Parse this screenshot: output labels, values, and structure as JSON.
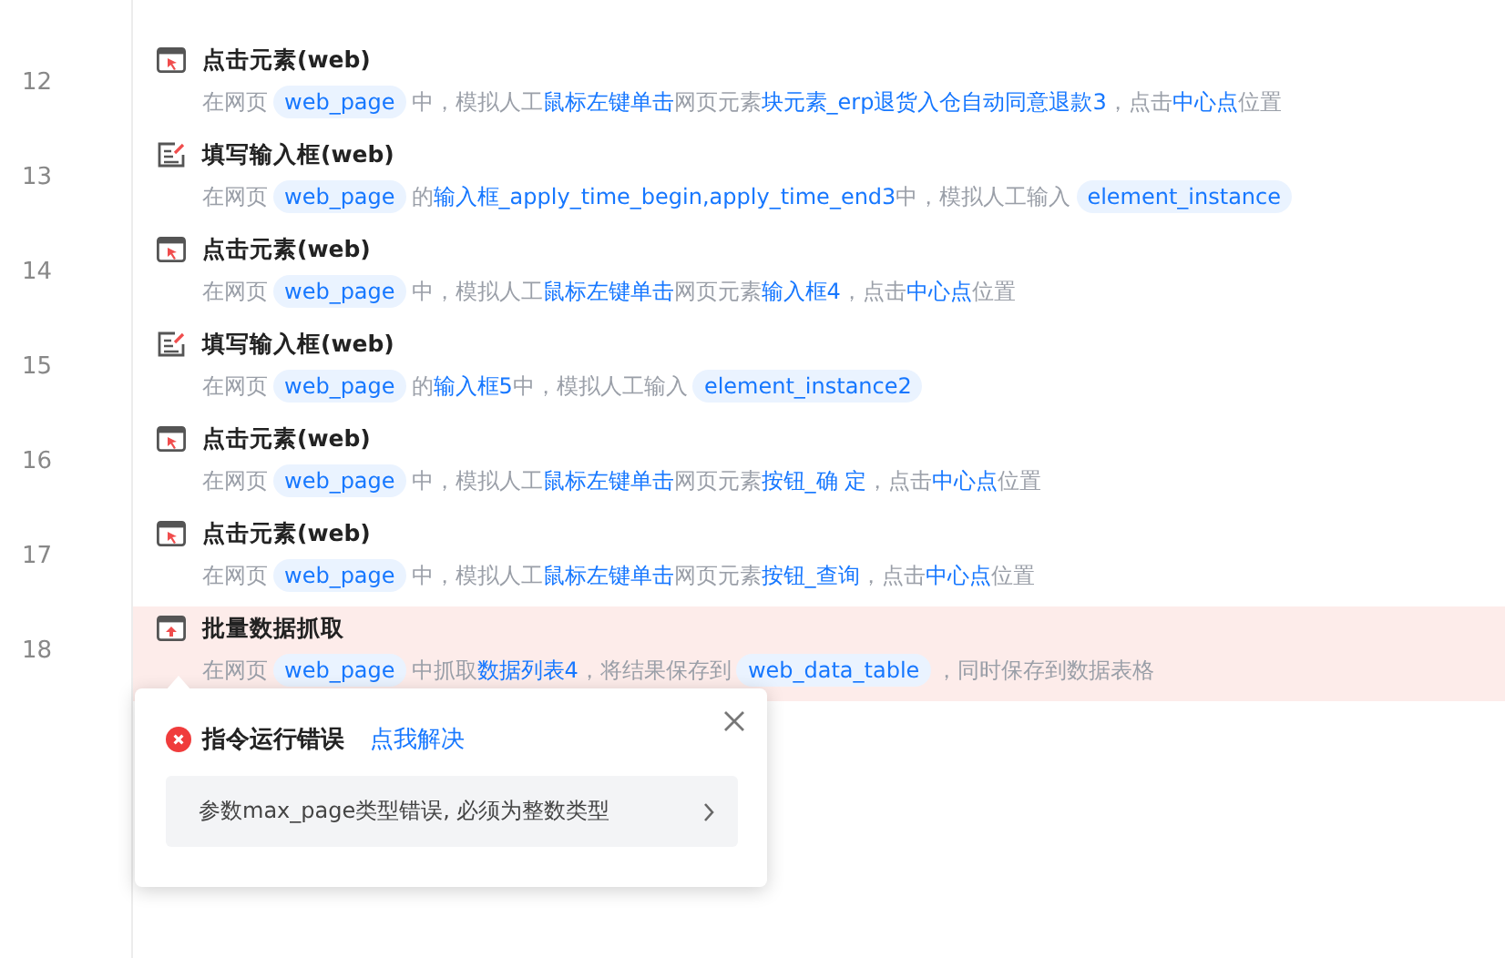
{
  "steps": [
    {
      "number": "12",
      "kind": "click",
      "title": "点击元素(web)",
      "error": false,
      "description": [
        {
          "kind": "text",
          "text": "在网页"
        },
        {
          "kind": "chip",
          "text": "web_page"
        },
        {
          "kind": "text",
          "text": "中，模拟人工"
        },
        {
          "kind": "link",
          "text": "鼠标左键单击"
        },
        {
          "kind": "text",
          "text": "网页元素"
        },
        {
          "kind": "link",
          "text": "块元素_erp退货入仓自动同意退款3"
        },
        {
          "kind": "text",
          "text": "，点击"
        },
        {
          "kind": "link",
          "text": "中心点"
        },
        {
          "kind": "text",
          "text": "位置"
        }
      ]
    },
    {
      "number": "13",
      "kind": "input",
      "title": "填写输入框(web)",
      "error": false,
      "description": [
        {
          "kind": "text",
          "text": "在网页"
        },
        {
          "kind": "chip",
          "text": "web_page"
        },
        {
          "kind": "text",
          "text": "的"
        },
        {
          "kind": "link",
          "text": "输入框_apply_time_begin,apply_time_end3"
        },
        {
          "kind": "text",
          "text": "中，模拟人工输入"
        },
        {
          "kind": "chip",
          "text": "element_instance"
        }
      ]
    },
    {
      "number": "14",
      "kind": "click",
      "title": "点击元素(web)",
      "error": false,
      "description": [
        {
          "kind": "text",
          "text": "在网页"
        },
        {
          "kind": "chip",
          "text": "web_page"
        },
        {
          "kind": "text",
          "text": "中，模拟人工"
        },
        {
          "kind": "link",
          "text": "鼠标左键单击"
        },
        {
          "kind": "text",
          "text": "网页元素"
        },
        {
          "kind": "link",
          "text": "输入框4"
        },
        {
          "kind": "text",
          "text": "，点击"
        },
        {
          "kind": "link",
          "text": "中心点"
        },
        {
          "kind": "text",
          "text": "位置"
        }
      ]
    },
    {
      "number": "15",
      "kind": "input",
      "title": "填写输入框(web)",
      "error": false,
      "description": [
        {
          "kind": "text",
          "text": "在网页"
        },
        {
          "kind": "chip",
          "text": "web_page"
        },
        {
          "kind": "text",
          "text": "的"
        },
        {
          "kind": "link",
          "text": "输入框5"
        },
        {
          "kind": "text",
          "text": "中，模拟人工输入"
        },
        {
          "kind": "chip",
          "text": "element_instance2"
        }
      ]
    },
    {
      "number": "16",
      "kind": "click",
      "title": "点击元素(web)",
      "error": false,
      "description": [
        {
          "kind": "text",
          "text": "在网页"
        },
        {
          "kind": "chip",
          "text": "web_page"
        },
        {
          "kind": "text",
          "text": "中，模拟人工"
        },
        {
          "kind": "link",
          "text": "鼠标左键单击"
        },
        {
          "kind": "text",
          "text": "网页元素"
        },
        {
          "kind": "link",
          "text": "按钮_确 定"
        },
        {
          "kind": "text",
          "text": "，点击"
        },
        {
          "kind": "link",
          "text": "中心点"
        },
        {
          "kind": "text",
          "text": "位置"
        }
      ]
    },
    {
      "number": "17",
      "kind": "click",
      "title": "点击元素(web)",
      "error": false,
      "description": [
        {
          "kind": "text",
          "text": "在网页"
        },
        {
          "kind": "chip",
          "text": "web_page"
        },
        {
          "kind": "text",
          "text": "中，模拟人工"
        },
        {
          "kind": "link",
          "text": "鼠标左键单击"
        },
        {
          "kind": "text",
          "text": "网页元素"
        },
        {
          "kind": "link",
          "text": "按钮_查询"
        },
        {
          "kind": "text",
          "text": "，点击"
        },
        {
          "kind": "link",
          "text": "中心点"
        },
        {
          "kind": "text",
          "text": "位置"
        }
      ]
    },
    {
      "number": "18",
      "kind": "scrape",
      "title": "批量数据抓取",
      "error": true,
      "description": [
        {
          "kind": "text",
          "text": "在网页"
        },
        {
          "kind": "chip",
          "text": "web_page"
        },
        {
          "kind": "text",
          "text": "中抓取"
        },
        {
          "kind": "link",
          "text": "数据列表4"
        },
        {
          "kind": "text",
          "text": "，将结果保存到"
        },
        {
          "kind": "chip",
          "text": "web_data_table"
        },
        {
          "kind": "text",
          "text": "，同时保存到数据表格"
        }
      ]
    }
  ],
  "error_popover": {
    "title": "指令运行错误",
    "action_link": "点我解决",
    "message": "参数max_page类型错误, 必须为整数类型"
  }
}
